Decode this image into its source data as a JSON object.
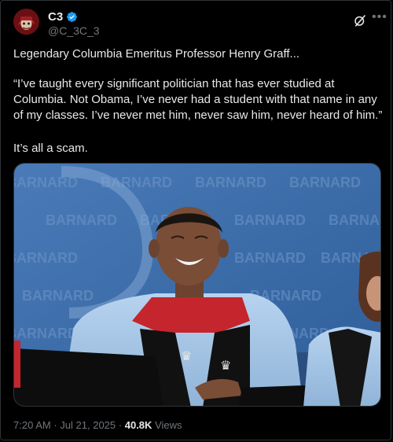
{
  "post": {
    "author_name": "C3",
    "handle": "@C_3C_3",
    "body_line1": "Legendary Columbia Emeritus Professor Henry Graff...",
    "body_quote": "“I’ve taught every significant politician that has ever studied at Columbia. Not Obama, I’ve never had a student with that name in any of my classes. I’ve never met him, never saw him, never heard of him.”",
    "body_closing": "It’s all a scam.",
    "backdrop_word": "BARNARD",
    "time": "7:20 AM",
    "date": "Jul 21, 2025",
    "separator": "·",
    "views_count": "40.8K",
    "views_label": "Views"
  },
  "icons": {
    "verified": "verified-badge-icon",
    "grok": "grok-icon",
    "more": "more-icon"
  },
  "colors": {
    "background": "#000000",
    "text": "#e7e9ea",
    "muted": "#71767b",
    "verified": "#1d9bf0",
    "backdrop_blue": "#3d6fae",
    "gown_blue": "#a9c9e8"
  }
}
